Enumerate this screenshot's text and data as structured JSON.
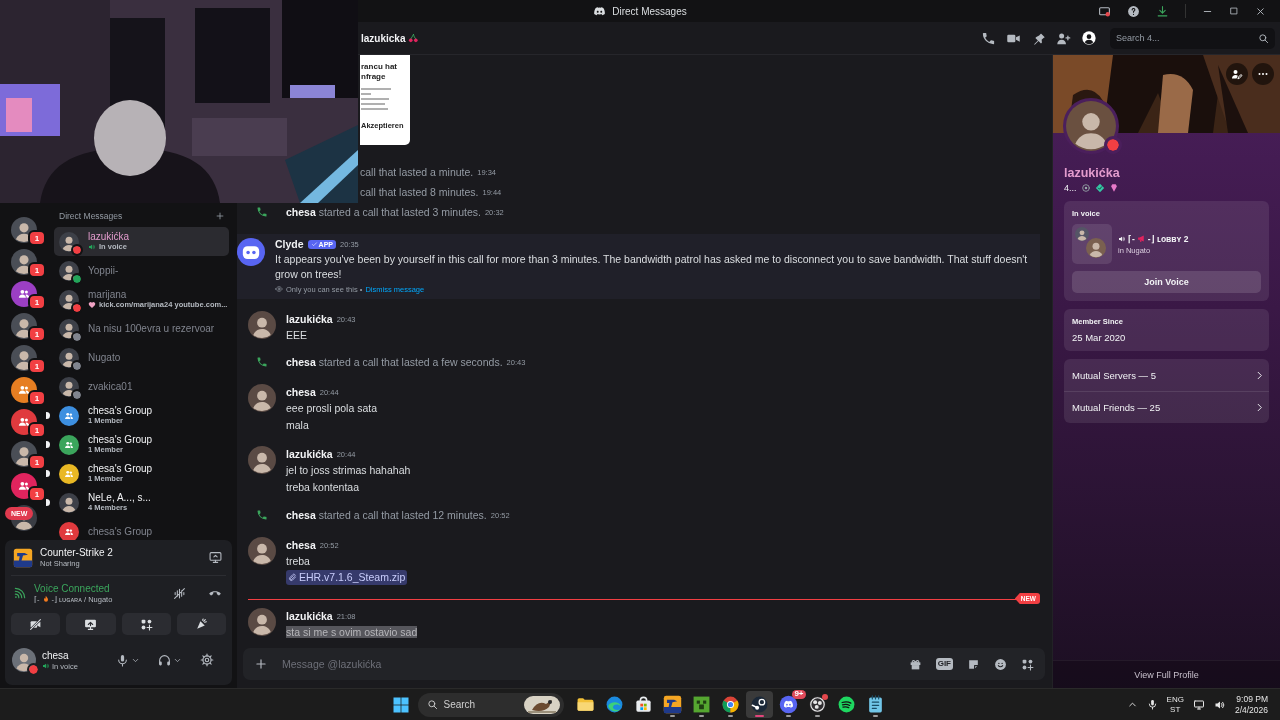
{
  "window": {
    "title": "Direct Messages"
  },
  "server_rail": {
    "items": [
      {
        "kind": "avatar",
        "badge": "1"
      },
      {
        "kind": "avatar",
        "badge": "1"
      },
      {
        "kind": "group",
        "color": "#9b3fc4",
        "badge": "1"
      },
      {
        "kind": "avatar",
        "badge": "1"
      },
      {
        "kind": "avatar",
        "badge": "1"
      },
      {
        "kind": "group",
        "color": "#e67e22",
        "badge": "1"
      },
      {
        "kind": "group",
        "color": "#e03a3e",
        "badge": "1"
      },
      {
        "kind": "avatar",
        "badge": "1"
      },
      {
        "kind": "group",
        "color": "#e0245e",
        "badge": "1"
      },
      {
        "kind": "new",
        "badge": "NEW"
      }
    ]
  },
  "dm_list": {
    "title": "Direct Messages",
    "items": [
      {
        "kind": "user",
        "name": "lazukićka",
        "subtitle": {
          "kind": "voice",
          "text": "In voice"
        },
        "status_dot": {
          "color": "#f23f43"
        },
        "selected": true,
        "unread": false
      },
      {
        "kind": "user",
        "name": "Yoppii-",
        "status_dot": {
          "color": "#23a55a"
        },
        "selected": false,
        "unread": false
      },
      {
        "kind": "user",
        "name": "marijana",
        "subtitle": {
          "kind": "custom_status",
          "text": "kick.com/marijana24 youtube.com..."
        },
        "status_dot": {
          "color": "#f23f43"
        },
        "selected": false,
        "unread": false
      },
      {
        "kind": "user",
        "name": "Na nisu 100evra u rezervoar",
        "status_dot": {
          "color": "#80848e"
        },
        "selected": false,
        "unread": false
      },
      {
        "kind": "user",
        "name": "Nugato",
        "status_dot": {
          "color": "#80848e"
        },
        "selected": false,
        "unread": false
      },
      {
        "kind": "user",
        "name": "zvakica01",
        "status_dot": {
          "color": "#80848e"
        },
        "selected": false,
        "unread": false
      },
      {
        "kind": "group",
        "name": "chesa's Group",
        "subtitle": {
          "kind": "members",
          "text": "1 Member"
        },
        "color": "#3d8fe0",
        "selected": false,
        "unread": true
      },
      {
        "kind": "group",
        "name": "chesa's Group",
        "subtitle": {
          "kind": "members",
          "text": "1 Member"
        },
        "color": "#3ba55c",
        "selected": false,
        "unread": true
      },
      {
        "kind": "group",
        "name": "chesa's Group",
        "subtitle": {
          "kind": "members",
          "text": "1 Member"
        },
        "color": "#e9b824",
        "selected": false,
        "unread": true
      },
      {
        "kind": "user",
        "name": "NeLe, A..., s...",
        "subtitle": {
          "kind": "members",
          "text": "4 Members"
        },
        "selected": false,
        "unread": true
      },
      {
        "kind": "group",
        "name": "chesa's Group",
        "color": "#e03a3e",
        "selected": false,
        "unread": false
      }
    ]
  },
  "user_panel": {
    "activity": {
      "title": "Counter-Strike 2",
      "subtitle": "Not Sharing"
    },
    "voice": {
      "status": "Voice Connected",
      "channel_prefix": "⌈-",
      "channel_suffix": "-⌋ ʟᴜɢᴀʀᴀ / Nugato"
    },
    "user": {
      "name": "chesa",
      "status_text": "In voice",
      "status_dot": {
        "color": "#f23f43"
      }
    }
  },
  "header": {
    "name": "lazukicka",
    "profile_toggle_on": true,
    "search_placeholder": "Search 4..."
  },
  "chat": {
    "messages": [
      {
        "kind": "embed_fragment",
        "title_lines": [
          "rancu hat",
          "nfrage"
        ],
        "button": "Akzeptieren"
      },
      {
        "kind": "call_cut",
        "text": "call that lasted a minute.",
        "time": "19:34"
      },
      {
        "kind": "call_cut",
        "text": "call that lasted 8 minutes.",
        "time": "19:44"
      },
      {
        "kind": "call",
        "author": "chesa",
        "text": "started a call that lasted 3 minutes.",
        "time": "20:32"
      },
      {
        "kind": "bot",
        "author": "Clyde",
        "tag": "APP",
        "time": "20:35",
        "text": "It appears you've been by yourself in this call for more than 3 minutes. The bandwidth patrol has asked me to disconnect you to save bandwidth. That stuff doesn't grow on trees!",
        "note": "Only you can see this •",
        "action": "Dismiss message"
      },
      {
        "kind": "message",
        "author": "lazukićka",
        "time": "20:43",
        "lines": [
          {
            "text": "EEE",
            "selected": false
          }
        ]
      },
      {
        "kind": "call",
        "author": "chesa",
        "text": "started a call that lasted a few seconds.",
        "time": "20:43"
      },
      {
        "kind": "message",
        "author": "chesa",
        "time": "20:44",
        "lines": [
          {
            "text": "eee prosli pola sata",
            "selected": false
          },
          {
            "text": "mala",
            "selected": false
          }
        ]
      },
      {
        "kind": "message",
        "author": "lazukićka",
        "time": "20:44",
        "lines": [
          {
            "text": "jel to joss strimas hahahah",
            "selected": false
          },
          {
            "text": "treba kontentaa",
            "selected": false
          }
        ]
      },
      {
        "kind": "call",
        "author": "chesa",
        "text": "started a call that lasted 12 minutes.",
        "time": "20:52"
      },
      {
        "kind": "message",
        "author": "chesa",
        "time": "20:52",
        "lines": [
          {
            "text": "treba",
            "selected": false
          }
        ],
        "attachment": "EHR.v7.1.6_Steam.zip"
      },
      {
        "kind": "new_divider",
        "label": "NEW"
      },
      {
        "kind": "message",
        "author": "lazukićka",
        "time": "21:08",
        "lines": [
          {
            "text": "sta si me s ovim ostavio sad",
            "selected": true
          }
        ]
      }
    ]
  },
  "composer": {
    "placeholder": "Message @lazukićka",
    "gif_label": "GIF"
  },
  "profile": {
    "name": "lazukićka",
    "tag": "4...",
    "status_dot": {
      "color": "#f23f43"
    },
    "in_voice": {
      "title": "In voice",
      "channel_prefix": "⌈-",
      "channel_suffix": "-⌋ ʟᴏʙʙʏ 2",
      "server": "in Nugato",
      "button": "Join Voice"
    },
    "member_since": {
      "title": "Member Since",
      "date": "25 Mar 2020"
    },
    "links": [
      {
        "label": "Mutual Servers — 5"
      },
      {
        "label": "Mutual Friends — 25"
      }
    ],
    "footer": "View Full Profile"
  },
  "taskbar": {
    "search_placeholder": "Search",
    "apps": [
      {
        "kind": "files",
        "active": false,
        "running": false
      },
      {
        "kind": "edge",
        "active": false,
        "running": false
      },
      {
        "kind": "store",
        "active": false,
        "running": false
      },
      {
        "kind": "cs2",
        "active": false,
        "running": true
      },
      {
        "kind": "minecraft",
        "active": false,
        "running": true
      },
      {
        "kind": "chrome",
        "active": false,
        "running": true
      },
      {
        "kind": "steam",
        "active": true,
        "running": true
      },
      {
        "kind": "discord",
        "active": false,
        "running": true,
        "badge": "9+"
      },
      {
        "kind": "obs",
        "active": false,
        "running": true,
        "alert": true
      },
      {
        "kind": "spotify",
        "active": false,
        "running": false
      },
      {
        "kind": "notepad",
        "active": false,
        "running": true
      }
    ],
    "language": "ENG",
    "layout": "ST",
    "time": "9:09 PM",
    "date": "2/4/2026"
  }
}
